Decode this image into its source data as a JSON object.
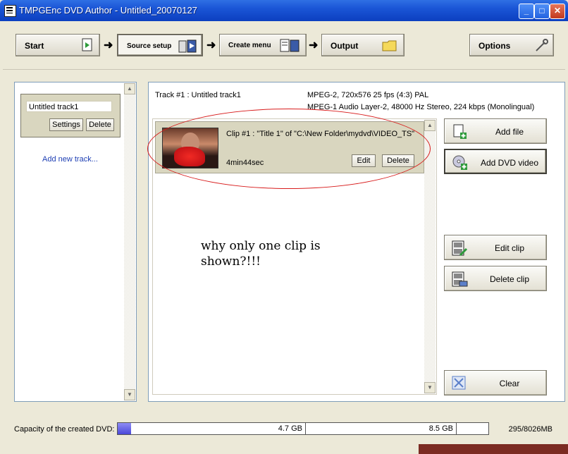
{
  "window": {
    "title": "TMPGEnc DVD Author - Untitled_20070127",
    "controls": {
      "minimize": "_",
      "maximize": "□",
      "close": "✕"
    }
  },
  "toolbar": {
    "steps": [
      {
        "label": "Start",
        "icon": "page-arrow-icon"
      },
      {
        "label": "Source setup",
        "icon": "film-box-icon",
        "active": true
      },
      {
        "label": "Create menu",
        "icon": "menu-book-icon"
      },
      {
        "label": "Output",
        "icon": "folder-icon"
      }
    ],
    "arrow": "➜",
    "options_label": "Options",
    "options_icon": "wrench-icon"
  },
  "tracks": {
    "items": [
      {
        "name": "Untitled track1",
        "settings_label": "Settings",
        "delete_label": "Delete"
      }
    ],
    "add_track_label": "Add new track..."
  },
  "track_info": {
    "title": "Track #1 : Untitled track1",
    "video": "MPEG-2, 720x576 25 fps (4:3) PAL",
    "audio": "MPEG-1 Audio Layer-2, 48000 Hz Stereo, 224 kbps (Monolingual)"
  },
  "clip": {
    "title": "Clip #1 : \"Title 1\" of \"C:\\New Folder\\mydvd\\VIDEO_TS\"",
    "duration": "4min44sec",
    "edit_label": "Edit",
    "delete_label": "Delete"
  },
  "annotation": {
    "text": "why only one clip is shown?!!!",
    "color": "#d81c1c"
  },
  "side_buttons": {
    "add_file": "Add file",
    "add_dvd_video": "Add DVD video",
    "edit_clip": "Edit clip",
    "delete_clip": "Delete clip",
    "clear": "Clear"
  },
  "capacity": {
    "label": "Capacity of the created DVD:",
    "mark_1": "4.7 GB",
    "mark_2": "8.5 GB",
    "readout": "295/8026MB",
    "used_fraction": 0.0368
  },
  "colors": {
    "titlebar": "#1a55d6",
    "panel_bg": "#ece9d8",
    "card_bg": "#d9d6bf",
    "link": "#1e3fb4"
  }
}
